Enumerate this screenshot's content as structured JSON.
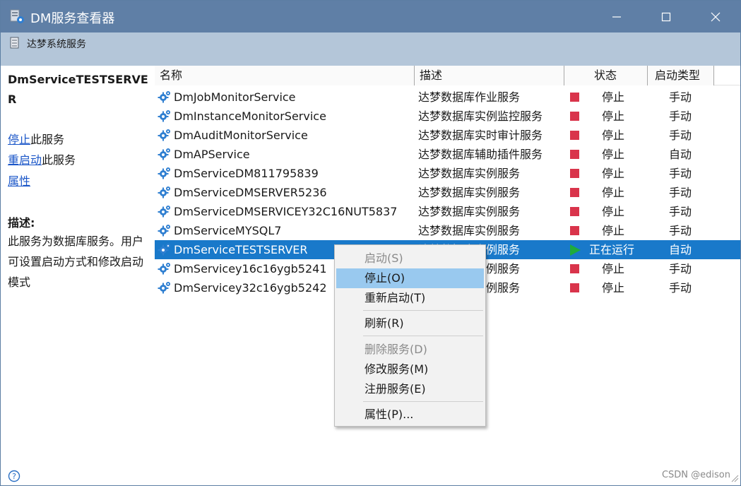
{
  "window": {
    "title": "DM服务查看器",
    "controls": {
      "minimize": "—",
      "maximize": "☐",
      "close": "✕"
    }
  },
  "toolbar": {
    "label": "达梦系统服务"
  },
  "sidebar": {
    "service_title": "DmServiceTESTSERVER",
    "actions": [
      {
        "link": "停止",
        "suffix": "此服务"
      },
      {
        "link": "重启动",
        "suffix": "此服务"
      },
      {
        "link": "属性",
        "suffix": ""
      }
    ],
    "description_heading": "描述:",
    "description_text": "此服务为数据库服务。用户可设置启动方式和修改启动模式"
  },
  "table": {
    "columns": [
      "名称",
      "描述",
      "状态",
      "启动类型"
    ],
    "rows": [
      {
        "name": "DmJobMonitorService",
        "desc": "达梦数据库作业服务",
        "status": "停止",
        "start": "手动",
        "running": false
      },
      {
        "name": "DmInstanceMonitorService",
        "desc": "达梦数据库实例监控服务",
        "status": "停止",
        "start": "手动",
        "running": false
      },
      {
        "name": "DmAuditMonitorService",
        "desc": "达梦数据库实时审计服务",
        "status": "停止",
        "start": "手动",
        "running": false
      },
      {
        "name": "DmAPService",
        "desc": "达梦数据库辅助插件服务",
        "status": "停止",
        "start": "自动",
        "running": false
      },
      {
        "name": "DmServiceDM811795839",
        "desc": "达梦数据库实例服务",
        "status": "停止",
        "start": "手动",
        "running": false
      },
      {
        "name": "DmServiceDMSERVER5236",
        "desc": "达梦数据库实例服务",
        "status": "停止",
        "start": "手动",
        "running": false
      },
      {
        "name": "DmServiceDMSERVICEY32C16NUT5837",
        "desc": "达梦数据库实例服务",
        "status": "停止",
        "start": "手动",
        "running": false
      },
      {
        "name": "DmServiceMYSQL7",
        "desc": "达梦数据库实例服务",
        "status": "停止",
        "start": "手动",
        "running": false
      },
      {
        "name": "DmServiceTESTSERVER",
        "desc": "达梦数据库实例服务",
        "status": "正在运行",
        "start": "自动",
        "running": true,
        "selected": true
      },
      {
        "name": "DmServicey16c16ygb5241",
        "desc": "达梦数据库实例服务",
        "status": "停止",
        "start": "手动",
        "running": false
      },
      {
        "name": "DmServicey32c16ygb5242",
        "desc": "达梦数据库实例服务",
        "status": "停止",
        "start": "手动",
        "running": false
      }
    ]
  },
  "context_menu": {
    "items": [
      {
        "label": "启动(S)",
        "disabled": true
      },
      {
        "label": "停止(O)",
        "hover": true
      },
      {
        "label": "重新启动(T)"
      },
      {
        "label": "刷新(R)"
      },
      {
        "label": "删除服务(D)",
        "disabled": true
      },
      {
        "label": "修改服务(M)"
      },
      {
        "label": "注册服务(E)"
      },
      {
        "label": "属性(P)..."
      }
    ]
  },
  "statusbar": {
    "watermark": "CSDN @edison"
  },
  "colors": {
    "titlebar": "#5f7fa6",
    "selection": "#1979ca",
    "stop": "#d9344b",
    "run": "#1fab3c",
    "menu_hover": "#99c9ef"
  },
  "icons": [
    "app-icon",
    "database-icon",
    "gear-icon",
    "help-icon",
    "size-grip-icon"
  ]
}
